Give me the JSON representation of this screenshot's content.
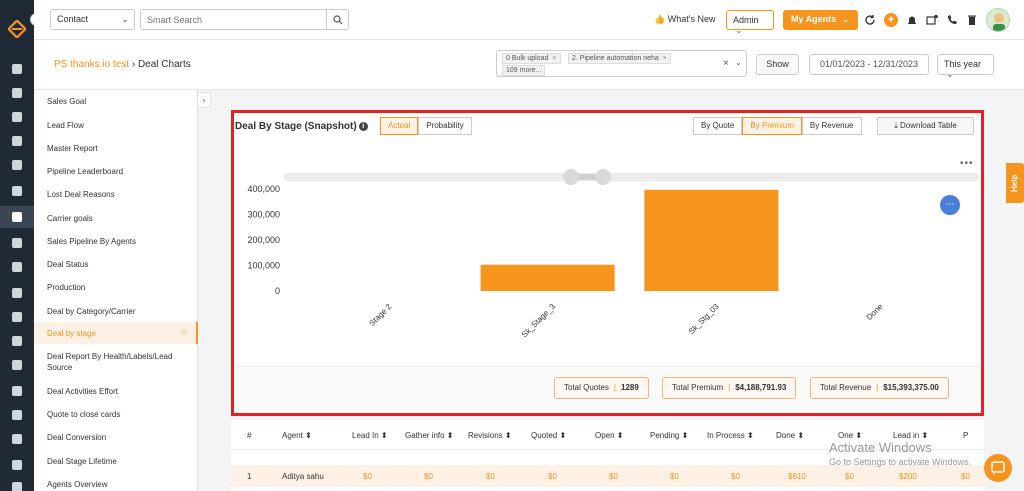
{
  "topbar": {
    "contact_select": "Contact",
    "search_placeholder": "Smart Search",
    "whats_new": "What's New",
    "admin_label": "Admin",
    "my_agents_label": "My Agents"
  },
  "breadcrumb": {
    "link": "PS thanks.io test",
    "current": "Deal Charts"
  },
  "filters": {
    "pipeline_tags": [
      "0 Bulk upload",
      "2. Pipeline automation neha",
      "109 more..."
    ],
    "show_label": "Show",
    "date_range": "01/01/2023 - 12/31/2023",
    "period": "This year"
  },
  "reports": [
    "Sales Goal",
    "Lead Flow",
    "Master Report",
    "Pipeline Leaderboard",
    "Lost Deal Reasons",
    "Carrier goals",
    "Sales Pipeline By Agents",
    "Deal Status",
    "Production",
    "Deal by Category/Carrier",
    "Deal by stage",
    "Deal Report By Health/Labels/Lead Source",
    "Deal Activities Effort",
    "Quote to close cards",
    "Deal Conversion",
    "Deal Stage Lifetime",
    "Agents Overview"
  ],
  "card": {
    "title": "Deal By Stage (Snapshot)",
    "mode_toggle": [
      "Actual",
      "Probability"
    ],
    "metric_toggle": [
      "By Quote",
      "By Premium",
      "By Revenue"
    ],
    "download_label": "Download Table"
  },
  "chart_data": {
    "type": "bar",
    "categories": [
      "Stage 2",
      "Sk_Stage_3",
      "Sk_Stg_03",
      "Done"
    ],
    "values": [
      0,
      103000,
      397000,
      0
    ],
    "ylim": [
      0,
      400000
    ],
    "yticks": [
      "400,000",
      "300,000",
      "200,000",
      "100,000",
      "0"
    ],
    "color": "#f7941d"
  },
  "totals": [
    {
      "label": "Total Quotes",
      "value": "1289"
    },
    {
      "label": "Total Premium",
      "value": "$4,188,791.93"
    },
    {
      "label": "Total Revenue",
      "value": "$15,393,375.00"
    }
  ],
  "table": {
    "headers": [
      "#",
      "Agent ⬍",
      "Lead In ⬍",
      "Gather info ⬍",
      "Revisions ⬍",
      "Quoted ⬍",
      "Open ⬍",
      "Pending ⬍",
      "In Process ⬍",
      "Done ⬍",
      "One ⬍",
      "Lead in ⬍",
      "P"
    ],
    "row": [
      "1",
      "Aditya sahu",
      "$0",
      "$0",
      "$0",
      "$0",
      "$0",
      "$0",
      "$0",
      "$610",
      "$0",
      "$200",
      "$0"
    ]
  },
  "help_label": "Help",
  "watermark": {
    "line1": "Activate Windows",
    "line2": "Go to Settings to activate Windows."
  }
}
